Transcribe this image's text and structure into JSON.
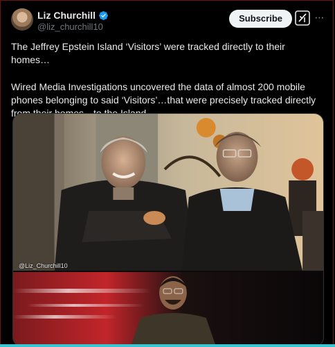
{
  "post": {
    "author": {
      "display_name": "Liz Churchill",
      "handle": "@liz_churchill10",
      "verified": true,
      "avatar_icon": "avatar"
    },
    "actions": {
      "subscribe_label": "Subscribe",
      "grok_icon": "grok-icon",
      "more_icon": "more-icon"
    },
    "text": {
      "paragraph_1": "The Jeffrey Epstein Island ‘Visitors’ were tracked directly to their homes…",
      "paragraph_2": "Wired Media Investigations uncovered the data of almost 200 mobile phones belonging to said ‘Visitors’…that were precisely tracked directly from their homes…to the Island."
    },
    "media": {
      "photo_watermark": "@Liz_Churchill10"
    }
  },
  "colors": {
    "background": "#000000",
    "verified_blue": "#1d9bf0",
    "subscribe_bg": "#eff3f4",
    "accent_bar": "#39c6d3"
  }
}
